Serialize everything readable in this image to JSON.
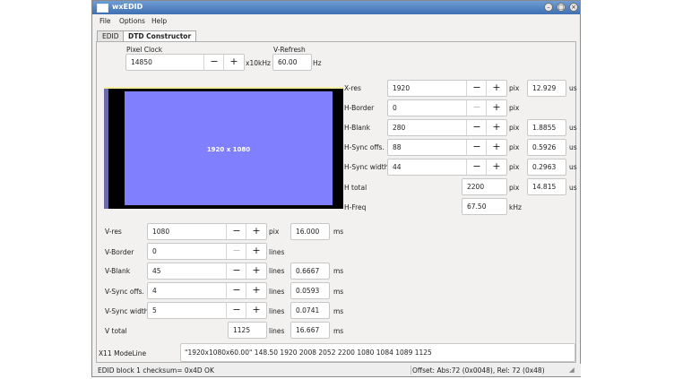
{
  "window": {
    "title": "wxEDID",
    "menu": [
      "File",
      "Options",
      "Help"
    ],
    "tabs": [
      "EDID",
      "DTD Constructor"
    ]
  },
  "top": {
    "pixel_clock": {
      "label": "Pixel Clock",
      "value": "14850",
      "unit": "x10kHz"
    },
    "v_refresh": {
      "label": "V-Refresh",
      "value": "60.00",
      "unit": "Hz"
    }
  },
  "preview": {
    "resolution_label": "1920 x 1080"
  },
  "horizontal": [
    {
      "label": "X-res",
      "value": "1920",
      "unit": "pix",
      "extra": "12.929",
      "extra_unit": "us"
    },
    {
      "label": "H-Border",
      "value": "0",
      "unit": "pix"
    },
    {
      "label": "H-Blank",
      "value": "280",
      "unit": "pix",
      "extra": "1.8855",
      "extra_unit": "us"
    },
    {
      "label": "H-Sync offs.",
      "value": "88",
      "unit": "pix",
      "extra": "0.5926",
      "extra_unit": "us"
    },
    {
      "label": "H-Sync width",
      "value": "44",
      "unit": "pix",
      "extra": "0.2963",
      "extra_unit": "us"
    }
  ],
  "h_total": {
    "label": "H total",
    "value": "2200",
    "unit": "pix",
    "extra": "14.815",
    "extra_unit": "us"
  },
  "h_freq": {
    "label": "H-Freq",
    "value": "67.50",
    "unit": "kHz"
  },
  "vertical": [
    {
      "label": "V-res",
      "value": "1080",
      "unit": "pix",
      "extra": "16.000",
      "extra_unit": "ms"
    },
    {
      "label": "V-Border",
      "value": "0",
      "unit": "lines"
    },
    {
      "label": "V-Blank",
      "value": "45",
      "unit": "lines",
      "extra": "0.6667",
      "extra_unit": "ms"
    },
    {
      "label": "V-Sync offs.",
      "value": "4",
      "unit": "lines",
      "extra": "0.0593",
      "extra_unit": "ms"
    },
    {
      "label": "V-Sync width",
      "value": "5",
      "unit": "lines",
      "extra": "0.0741",
      "extra_unit": "ms"
    }
  ],
  "v_total": {
    "label": "V total",
    "value": "1125",
    "unit": "lines",
    "extra": "16.667",
    "extra_unit": "ms"
  },
  "modeline": {
    "label": "X11 ModeLine",
    "value": "\"1920x1080x60.00\" 148.50 1920 2008 2052 2200 1080 1084 1089 1125"
  },
  "status": {
    "left": "EDID block 1 checksum= 0x4D OK",
    "right": "Offset: Abs:72 (0x0048), Rel: 72 (0x48)"
  },
  "icons": {
    "minus": "−",
    "plus": "+",
    "minimize": "minimize-icon",
    "maximize": "maximize-icon",
    "close": "close-icon"
  }
}
